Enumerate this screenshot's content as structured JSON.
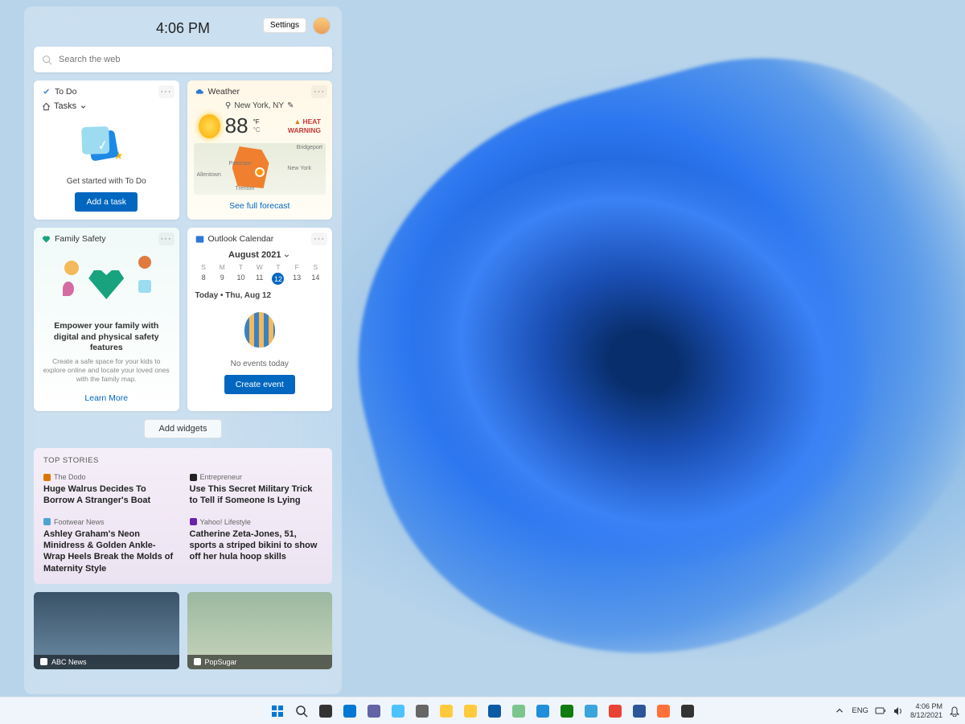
{
  "panel": {
    "clock": "4:06 PM",
    "settings_label": "Settings",
    "search_placeholder": "Search the web"
  },
  "todo": {
    "title": "To Do",
    "tasks_label": "Tasks",
    "caption": "Get started with To Do",
    "button": "Add a task"
  },
  "weather": {
    "title": "Weather",
    "location": "New York, NY",
    "temp": "88",
    "unit_f": "°F",
    "unit_c": "°C",
    "warning_icon": "▲",
    "warning": "HEAT WARNING",
    "forecast_link": "See full forecast",
    "map_labels": {
      "a": "Bridgeport",
      "b": "Paterson",
      "c": "New York",
      "d": "Allentown",
      "e": "Trenton"
    }
  },
  "family": {
    "title": "Family Safety",
    "heading": "Empower your family with digital and physical safety features",
    "sub": "Create a safe space for your kids to explore online and locate your loved ones with the family map.",
    "link": "Learn More"
  },
  "calendar": {
    "title": "Outlook Calendar",
    "month": "August 2021",
    "dows": [
      "S",
      "M",
      "T",
      "W",
      "T",
      "F",
      "S"
    ],
    "days": [
      "8",
      "9",
      "10",
      "11",
      "12",
      "13",
      "14"
    ],
    "today_index": 4,
    "today_label": "Today • Thu, Aug 12",
    "no_events": "No events today",
    "button": "Create event"
  },
  "add_widgets": "Add widgets",
  "news": {
    "heading": "TOP STORIES",
    "items": [
      {
        "source": "The Dodo",
        "color": "#d97706",
        "headline": "Huge Walrus Decides To Borrow A Stranger's Boat"
      },
      {
        "source": "Entrepreneur",
        "color": "#222",
        "headline": "Use This Secret Military Trick to Tell if Someone Is Lying"
      },
      {
        "source": "Footwear News",
        "color": "#4fa3d1",
        "headline": "Ashley Graham's Neon Minidress & Golden Ankle-Wrap Heels Break the Molds of Maternity Style"
      },
      {
        "source": "Yahoo! Lifestyle",
        "color": "#6b21a8",
        "headline": "Catherine Zeta-Jones, 51, sports a striped bikini to show off her hula hoop skills"
      }
    ],
    "thumbs": [
      {
        "source": "ABC News"
      },
      {
        "source": "PopSugar"
      }
    ]
  },
  "taskbar": {
    "lang": "ENG",
    "time": "4:06 PM",
    "date": "8/12/2021",
    "icons": [
      "start",
      "search",
      "task-view",
      "widgets",
      "chat",
      "photos",
      "settings",
      "explorer",
      "folder",
      "edge",
      "sticky",
      "store",
      "xbox",
      "maps",
      "chrome",
      "word",
      "firefox",
      "terminal"
    ]
  }
}
